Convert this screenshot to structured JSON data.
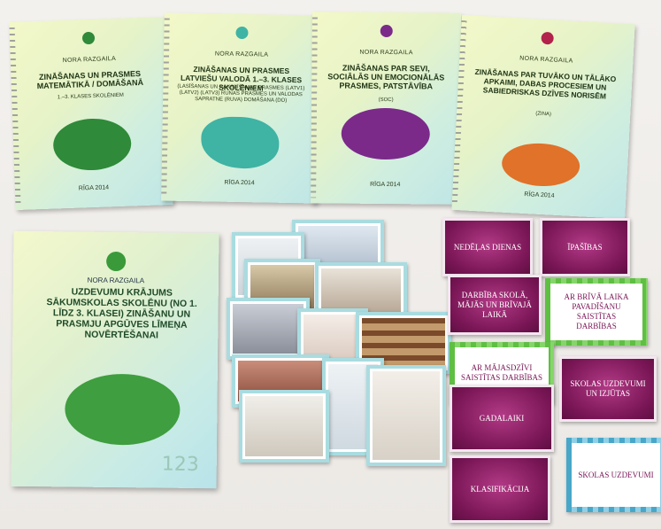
{
  "books": [
    {
      "author": "NORA RAZGAILA",
      "title": "ZINĀŠANAS UN PRASMES MATEMĀTIKĀ / DOMĀŠANĀ",
      "sub": "1.–3. KLASES SKOLĒNIEM",
      "city": "RĪGA 2014",
      "accent": "#2f8a3a"
    },
    {
      "author": "NORA RAZGAILA",
      "title": "ZINĀŠANAS UN PRASMES LATVIEŠU VALODĀ 1.–3. KLASES SKOLĒNIEM",
      "sub": "(LASĪŠANAS UN RAKSTĪŠANAS PRASMES (LATV1) (LATV2) (LATV3) RUNAS PRASMES UN VALODAS SAPRATNE (RUVA) DOMĀŠANA (DO)",
      "city": "RĪGA 2014",
      "accent": "#3fb3a4"
    },
    {
      "author": "NORA RAZGAILA",
      "title": "ZINĀŠANAS PAR SEVI, SOCIĀLĀS UN EMOCIONĀLĀS PRASMES, PATSTĀVĪBA",
      "sub": "(SOC)",
      "city": "RĪGA 2014",
      "accent": "#7b2a8a"
    },
    {
      "author": "NORA RAZGAILA",
      "title": "ZINĀŠANAS PAR TUVĀKO UN TĀLĀKO APKAIMI, DABAS PROCESIEM UN SABIEDRISKAS DZĪVES NORISĒM",
      "sub": "(ZINA)",
      "city": "RĪGA 2014",
      "accent": "#e0722a"
    }
  ],
  "bigbook": {
    "author": "NORA RAZGAILA",
    "title": "UZDEVUMU KRĀJUMS SĀKUMSKOLAS SKOLĒNU (NO 1. LĪDZ 3. KLASEI) ZINĀŠANU UN PRASMJU APGŪVES LĪMEŅA NOVĒRTĒŠANAI",
    "num": "123"
  },
  "cards": {
    "c1": "NEDĒĻAS DIENAS",
    "c2": "ĪPAŠĪBAS",
    "c3": "DARBĪBA SKOLĀ, MĀJĀS UN BRĪVAJĀ LAIKĀ",
    "c4": "AR BRĪVĀ LAIKA PAVADĪŠANU SAISTĪTAS DARBĪBAS",
    "c5": "AR MĀJASDZĪVI SAISTĪTAS DARBĪBAS",
    "c6": "SKOLAS UZDEVUMI UN IZJŪTAS",
    "c7": "GADALAIKI",
    "c8": "KLASIFIKĀCIJA",
    "c9": "SKOLAS UZDEVUMI"
  }
}
